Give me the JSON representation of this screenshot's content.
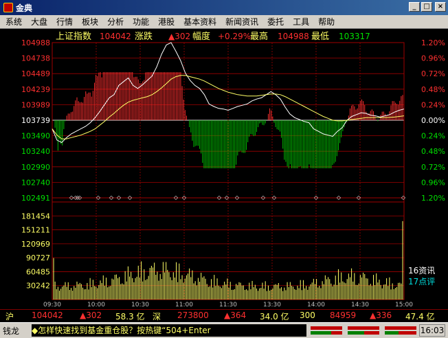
{
  "window": {
    "title": "金典"
  },
  "menu": [
    "系统",
    "大盘",
    "行情",
    "板块",
    "分析",
    "功能",
    "港股",
    "基本资料",
    "新闻资讯",
    "委托",
    "工具",
    "帮助"
  ],
  "header": {
    "name": "上证指数",
    "price": "104042",
    "change_label": "涨跌",
    "change": "▲302",
    "pct_label": "幅度",
    "pct": "+0.29%",
    "high_label": "最高",
    "high": "104988",
    "low_label": "最低",
    "low": "103317"
  },
  "price_axis_left": [
    "104988",
    "104738",
    "104489",
    "104239",
    "103989",
    "103739",
    "103490",
    "103240",
    "102990",
    "102740",
    "102491"
  ],
  "pct_axis_right": [
    "1.20%",
    "0.96%",
    "0.72%",
    "0.48%",
    "0.24%",
    "0.00%",
    "0.24%",
    "0.48%",
    "0.72%",
    "0.96%",
    "1.20%"
  ],
  "volume_axis_left": [
    "181454",
    "151211",
    "120969",
    "90727",
    "60485",
    "30242"
  ],
  "time_axis": [
    "09:30",
    "10:00",
    "10:30",
    "11:00",
    "11:30",
    "13:30",
    "14:00",
    "14:30",
    "15:00"
  ],
  "side_info": {
    "news": "16资讯",
    "comments": "17点评"
  },
  "status": {
    "sh_label": "沪",
    "sh_price": "104042",
    "sh_change": "▲302",
    "sh_amount": "58.3 亿",
    "sz_label": "深",
    "sz_price": "273800",
    "sz_change": "▲364",
    "sz_amount": "34.0 亿",
    "c300_label": "300",
    "c300_price": "84959",
    "c300_change": "▲336",
    "c300_amount": "47.4 亿"
  },
  "ticker": {
    "label": "钱龙",
    "text": "◆怎样快速找到基金重仓股？按热键“504+Enter",
    "clock": "16:03"
  },
  "colors": {
    "up": "#ff3030",
    "down": "#00c000",
    "price_line": "#ffffff",
    "avg_line": "#ffff66",
    "grid": "#a00000",
    "axis_text_red": "#ff3030",
    "axis_text_green": "#00e000",
    "volume": "#ffff66"
  },
  "chart_data": {
    "type": "line",
    "title": "",
    "x_labels": [
      "09:30",
      "10:00",
      "10:30",
      "11:00",
      "11:30",
      "13:30",
      "14:00",
      "14:30",
      "15:00"
    ],
    "ylim_price": [
      102491,
      104988
    ],
    "prev_close": 103739,
    "volume_ylim": [
      0,
      211696
    ],
    "series": [
      {
        "values": [
          103600,
          103420,
          103380,
          103460,
          103520,
          103560,
          103600,
          103640,
          103700,
          103780,
          103880,
          103990,
          104100,
          104150,
          104300,
          104360,
          104420,
          104300,
          104250,
          104310,
          104380,
          104450,
          104600,
          104800,
          104950,
          104988,
          104850,
          104700,
          104500,
          104380,
          104300,
          104250,
          104150,
          104000,
          103960,
          103930,
          103920,
          103900,
          103930,
          103960,
          103980,
          104000,
          104050,
          104080,
          104100,
          104150,
          104200,
          104150,
          104080,
          103950,
          103840,
          103780,
          103750,
          103720,
          103700,
          103600,
          103560,
          103520,
          103500,
          103480,
          103560,
          103620,
          103740,
          103800,
          103830,
          103860,
          103850,
          103820,
          103810,
          103790,
          103810,
          103830,
          103870,
          103900,
          103920
        ]
      },
      {
        "values": [
          103600,
          103500,
          103440,
          103440,
          103460,
          103480,
          103500,
          103530,
          103560,
          103600,
          103660,
          103720,
          103790,
          103850,
          103920,
          103980,
          104030,
          104060,
          104080,
          104100,
          104120,
          104150,
          104200,
          104260,
          104330,
          104400,
          104440,
          104460,
          104460,
          104440,
          104420,
          104400,
          104370,
          104330,
          104290,
          104250,
          104220,
          104190,
          104170,
          104150,
          104140,
          104130,
          104130,
          104130,
          104140,
          104150,
          104160,
          104160,
          104150,
          104120,
          104080,
          104040,
          104000,
          103960,
          103920,
          103880,
          103840,
          103800,
          103770,
          103740,
          103730,
          103730,
          103740,
          103750,
          103760,
          103770,
          103780,
          103780,
          103780,
          103780,
          103780,
          103785,
          103790,
          103800,
          103810
        ]
      }
    ]
  }
}
